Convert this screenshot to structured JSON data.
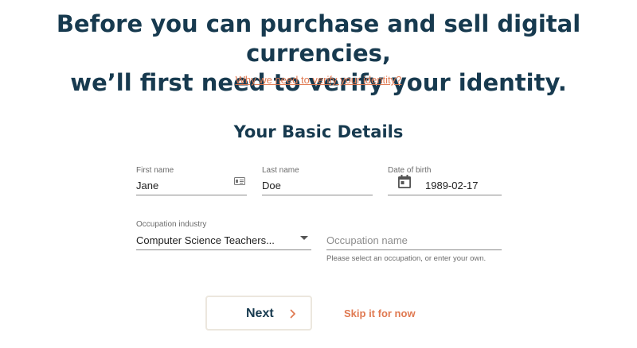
{
  "header": {
    "headline_line1": "Before you can purchase and sell digital currencies,",
    "headline_line2": "we’ll first need to verify your identity.",
    "why_link": "Why we need to verify your identity?"
  },
  "form": {
    "section_title": "Your Basic Details",
    "first_name": {
      "label": "First name",
      "value": "Jane",
      "icon": "id-card-icon"
    },
    "last_name": {
      "label": "Last name",
      "value": "Doe"
    },
    "date_of_birth": {
      "label": "Date of birth",
      "value": "1989-02-17",
      "icon": "calendar-icon"
    },
    "occupation_industry": {
      "label": "Occupation industry",
      "selected": "Computer Science Teachers...",
      "icon": "dropdown-caret-icon"
    },
    "occupation_name": {
      "placeholder": "Occupation name",
      "hint": "Please select an occupation, or enter your own."
    }
  },
  "actions": {
    "next_label": "Next",
    "next_icon": "chevron-right-icon",
    "skip_label": "Skip it for now"
  },
  "colors": {
    "heading": "#173a4f",
    "accent": "#e07a52",
    "button_border": "#ece7de"
  }
}
